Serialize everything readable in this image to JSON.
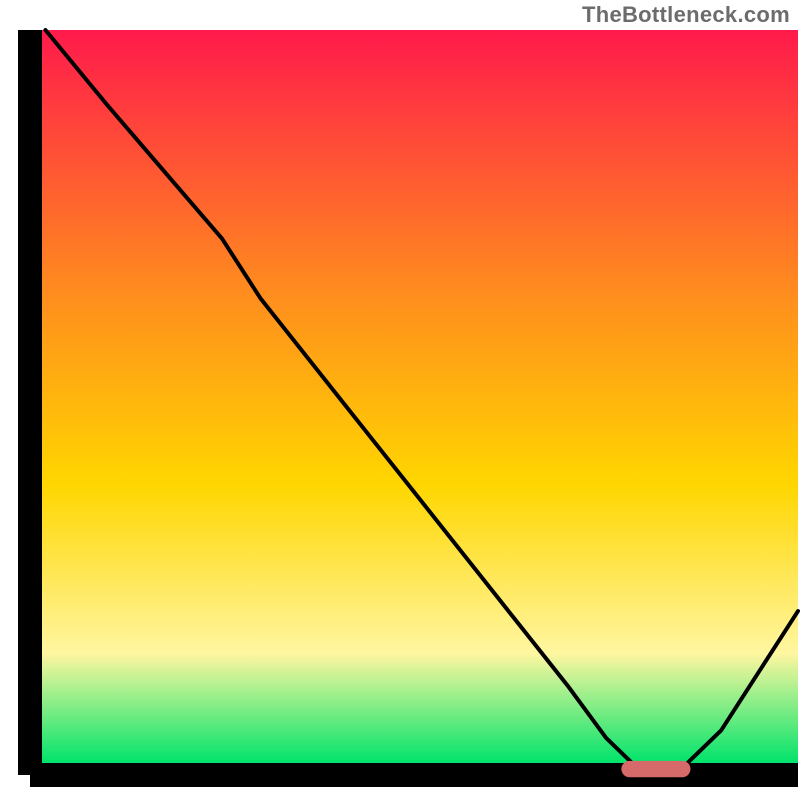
{
  "watermark": "TheBottleneck.com",
  "chart_data": {
    "type": "line",
    "title": "",
    "xlabel": "",
    "ylabel": "",
    "xlim": [
      0,
      100
    ],
    "ylim": [
      0,
      100
    ],
    "grid": false,
    "legend": false,
    "gradient_colors": {
      "top": "#ff1a4b",
      "upper_mid": "#ff8a1f",
      "mid": "#ffd600",
      "lower_mid": "#fff6a0",
      "bottom": "#00e36b"
    },
    "series": [
      {
        "name": "bottleneck-curve",
        "color": "#000000",
        "x": [
          2,
          10,
          20,
          25,
          30,
          40,
          50,
          60,
          70,
          75,
          79,
          85,
          90,
          95,
          100
        ],
        "y": [
          100,
          90,
          78,
          72,
          64,
          51,
          38,
          25,
          12,
          5,
          1,
          1,
          6,
          14,
          22
        ]
      }
    ],
    "marker": {
      "name": "optimal-range",
      "color": "#d66a6a",
      "x_start": 77,
      "x_end": 86,
      "y": 0.8,
      "thickness": 2.2
    },
    "axes": {
      "left_x": 3.6,
      "right_x": 100,
      "bottom_y": 0,
      "top_y": 100,
      "stroke": "#000000",
      "stroke_width": 3.5
    }
  }
}
